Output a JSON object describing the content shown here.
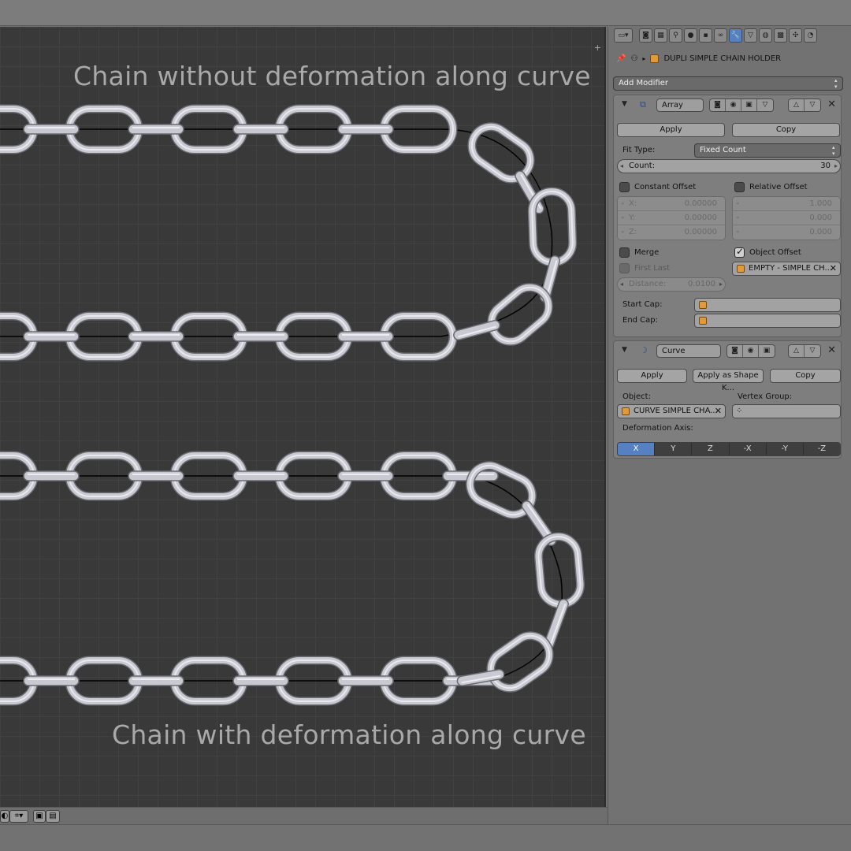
{
  "viewport": {
    "caption_top": "Chain without deformation along curve",
    "caption_bottom": "Chain with deformation along curve"
  },
  "properties": {
    "context_object": "DUPLI SIMPLE CHAIN HOLDER",
    "add_modifier_label": "Add Modifier",
    "array": {
      "name": "Array",
      "apply_label": "Apply",
      "copy_label": "Copy",
      "fit_type_label": "Fit Type:",
      "fit_type_value": "Fixed Count",
      "count_label": "Count:",
      "count_value": "30",
      "constant_offset_label": "Constant Offset",
      "constant_offset_checked": false,
      "relative_offset_label": "Relative Offset",
      "relative_offset_checked": false,
      "constant_x_label": "X:",
      "constant_x": "0.00000",
      "constant_y_label": "Y:",
      "constant_y": "0.00000",
      "constant_z_label": "Z:",
      "constant_z": "0.00000",
      "relative_x": "1.000",
      "relative_y": "0.000",
      "relative_z": "0.000",
      "merge_label": "Merge",
      "merge_checked": false,
      "first_last_label": "First Last",
      "distance_label": "Distance:",
      "distance_value": "0.0100",
      "object_offset_label": "Object Offset",
      "object_offset_checked": true,
      "object_offset_value": "EMPTY - SIMPLE CH...",
      "start_cap_label": "Start Cap:",
      "end_cap_label": "End Cap:"
    },
    "curve": {
      "name": "Curve",
      "apply_label": "Apply",
      "apply_shape_label": "Apply as Shape K...",
      "copy_label": "Copy",
      "object_label": "Object:",
      "object_value": "CURVE SIMPLE CHA...",
      "vertex_group_label": "Vertex Group:",
      "deformation_axis_label": "Deformation Axis:",
      "axes": [
        "X",
        "Y",
        "Z",
        "-X",
        "-Y",
        "-Z"
      ],
      "selected_axis": "X"
    }
  },
  "colors": {
    "viewport_bg": "#393939",
    "panel_bg": "#727272",
    "accent": "#5680c2",
    "caption": "#a9a9a9",
    "chain": "#c9c9d2"
  }
}
